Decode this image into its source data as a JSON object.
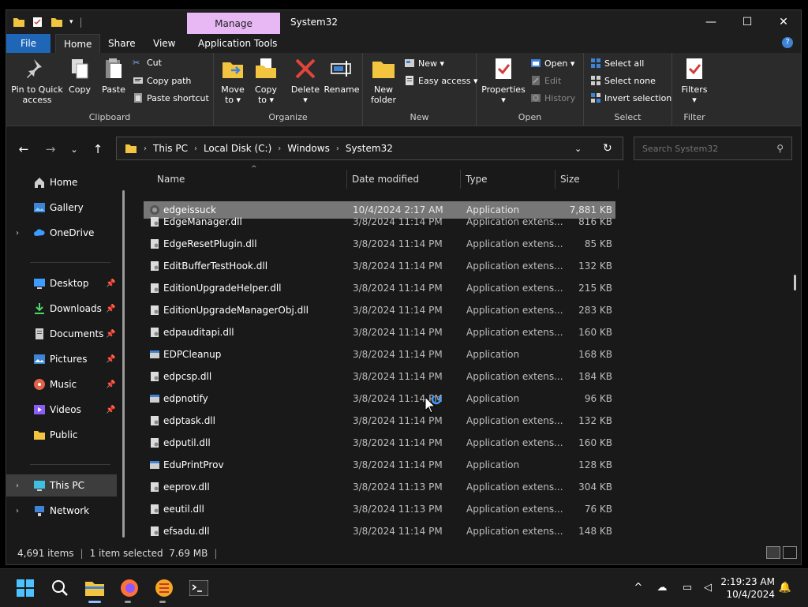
{
  "window": {
    "title": "System32",
    "manage_tab": "Manage",
    "controls": {
      "minimize": "—",
      "maximize": "☐",
      "close": "✕"
    }
  },
  "ribbon_tabs": [
    "File",
    "Home",
    "Share",
    "View",
    "Application Tools"
  ],
  "ribbon": {
    "clipboard": {
      "label": "Clipboard",
      "pin": "Pin to Quick\naccess",
      "copy": "Copy",
      "paste": "Paste",
      "cut": "Cut",
      "copy_path": "Copy path",
      "paste_shortcut": "Paste shortcut"
    },
    "organize": {
      "label": "Organize",
      "move_to": "Move\nto ▾",
      "copy_to": "Copy\nto ▾",
      "delete": "Delete\n▾",
      "rename": "Rename"
    },
    "new": {
      "label": "New",
      "new_folder": "New\nfolder",
      "new_item": "New ▾",
      "easy_access": "Easy access ▾"
    },
    "open": {
      "label": "Open",
      "properties": "Properties\n▾",
      "open": "Open ▾",
      "edit": "Edit",
      "history": "History"
    },
    "select": {
      "label": "Select",
      "select_all": "Select all",
      "select_none": "Select none",
      "invert": "Invert selection"
    },
    "filter": {
      "label": "Filter",
      "filters": "Filters\n▾"
    }
  },
  "address": {
    "crumbs": [
      "This PC",
      "Local Disk (C:)",
      "Windows",
      "System32"
    ],
    "search_placeholder": "Search System32"
  },
  "sidebar": {
    "items": [
      {
        "label": "Home",
        "icon": "home-icon",
        "expandable": false,
        "pinned": false
      },
      {
        "label": "Gallery",
        "icon": "gallery-icon",
        "expandable": false,
        "pinned": false
      },
      {
        "label": "OneDrive",
        "icon": "cloud-icon",
        "expandable": true,
        "pinned": false
      },
      {
        "label": "Desktop",
        "icon": "desktop-icon",
        "expandable": false,
        "pinned": true
      },
      {
        "label": "Downloads",
        "icon": "download-icon",
        "expandable": false,
        "pinned": true
      },
      {
        "label": "Documents",
        "icon": "document-icon",
        "expandable": false,
        "pinned": true
      },
      {
        "label": "Pictures",
        "icon": "pictures-icon",
        "expandable": false,
        "pinned": true
      },
      {
        "label": "Music",
        "icon": "music-icon",
        "expandable": false,
        "pinned": true
      },
      {
        "label": "Videos",
        "icon": "video-icon",
        "expandable": false,
        "pinned": true
      },
      {
        "label": "Public",
        "icon": "folder-icon",
        "expandable": false,
        "pinned": false
      },
      {
        "label": "This PC",
        "icon": "monitor-icon",
        "expandable": true,
        "pinned": false,
        "selected": true
      },
      {
        "label": "Network",
        "icon": "network-icon",
        "expandable": true,
        "pinned": false
      }
    ]
  },
  "columns": {
    "name": "Name",
    "date": "Date modified",
    "type": "Type",
    "size": "Size"
  },
  "files": [
    {
      "name": "edgeissuck",
      "date": "10/4/2024 2:17 AM",
      "type": "Application",
      "size": "7,881 KB",
      "icon": "edge-app",
      "selected": true
    },
    {
      "name": "EdgeManager.dll",
      "date": "3/8/2024 11:14 PM",
      "type": "Application extens...",
      "size": "816 KB",
      "icon": "dll"
    },
    {
      "name": "EdgeResetPlugin.dll",
      "date": "3/8/2024 11:14 PM",
      "type": "Application extens...",
      "size": "85 KB",
      "icon": "dll"
    },
    {
      "name": "EditBufferTestHook.dll",
      "date": "3/8/2024 11:14 PM",
      "type": "Application extens...",
      "size": "132 KB",
      "icon": "dll"
    },
    {
      "name": "EditionUpgradeHelper.dll",
      "date": "3/8/2024 11:14 PM",
      "type": "Application extens...",
      "size": "215 KB",
      "icon": "dll"
    },
    {
      "name": "EditionUpgradeManagerObj.dll",
      "date": "3/8/2024 11:14 PM",
      "type": "Application extens...",
      "size": "283 KB",
      "icon": "dll"
    },
    {
      "name": "edpauditapi.dll",
      "date": "3/8/2024 11:14 PM",
      "type": "Application extens...",
      "size": "160 KB",
      "icon": "dll"
    },
    {
      "name": "EDPCleanup",
      "date": "3/8/2024 11:14 PM",
      "type": "Application",
      "size": "168 KB",
      "icon": "exe"
    },
    {
      "name": "edpcsp.dll",
      "date": "3/8/2024 11:14 PM",
      "type": "Application extens...",
      "size": "184 KB",
      "icon": "dll"
    },
    {
      "name": "edpnotify",
      "date": "3/8/2024 11:14 PM",
      "type": "Application",
      "size": "96 KB",
      "icon": "exe"
    },
    {
      "name": "edptask.dll",
      "date": "3/8/2024 11:14 PM",
      "type": "Application extens...",
      "size": "132 KB",
      "icon": "dll"
    },
    {
      "name": "edputil.dll",
      "date": "3/8/2024 11:14 PM",
      "type": "Application extens...",
      "size": "160 KB",
      "icon": "dll"
    },
    {
      "name": "EduPrintProv",
      "date": "3/8/2024 11:14 PM",
      "type": "Application",
      "size": "128 KB",
      "icon": "exe"
    },
    {
      "name": "eeprov.dll",
      "date": "3/8/2024 11:13 PM",
      "type": "Application extens...",
      "size": "304 KB",
      "icon": "dll"
    },
    {
      "name": "eeutil.dll",
      "date": "3/8/2024 11:13 PM",
      "type": "Application extens...",
      "size": "76 KB",
      "icon": "dll"
    },
    {
      "name": "efsadu.dll",
      "date": "3/8/2024 11:14 PM",
      "type": "Application extens...",
      "size": "148 KB",
      "icon": "dll"
    }
  ],
  "status": {
    "items": "4,691 items",
    "selected": "1 item selected  7.69 MB"
  },
  "taskbar": {
    "time": "2:19:23 AM",
    "date": "10/4/2024",
    "apps": [
      "start-icon",
      "search-icon",
      "file-explorer-icon",
      "firefox-icon",
      "browser-icon",
      "terminal-icon"
    ]
  },
  "colors": {
    "accent": "#1f66b8",
    "manage": "#e7b8f3",
    "selection": "#777777"
  }
}
